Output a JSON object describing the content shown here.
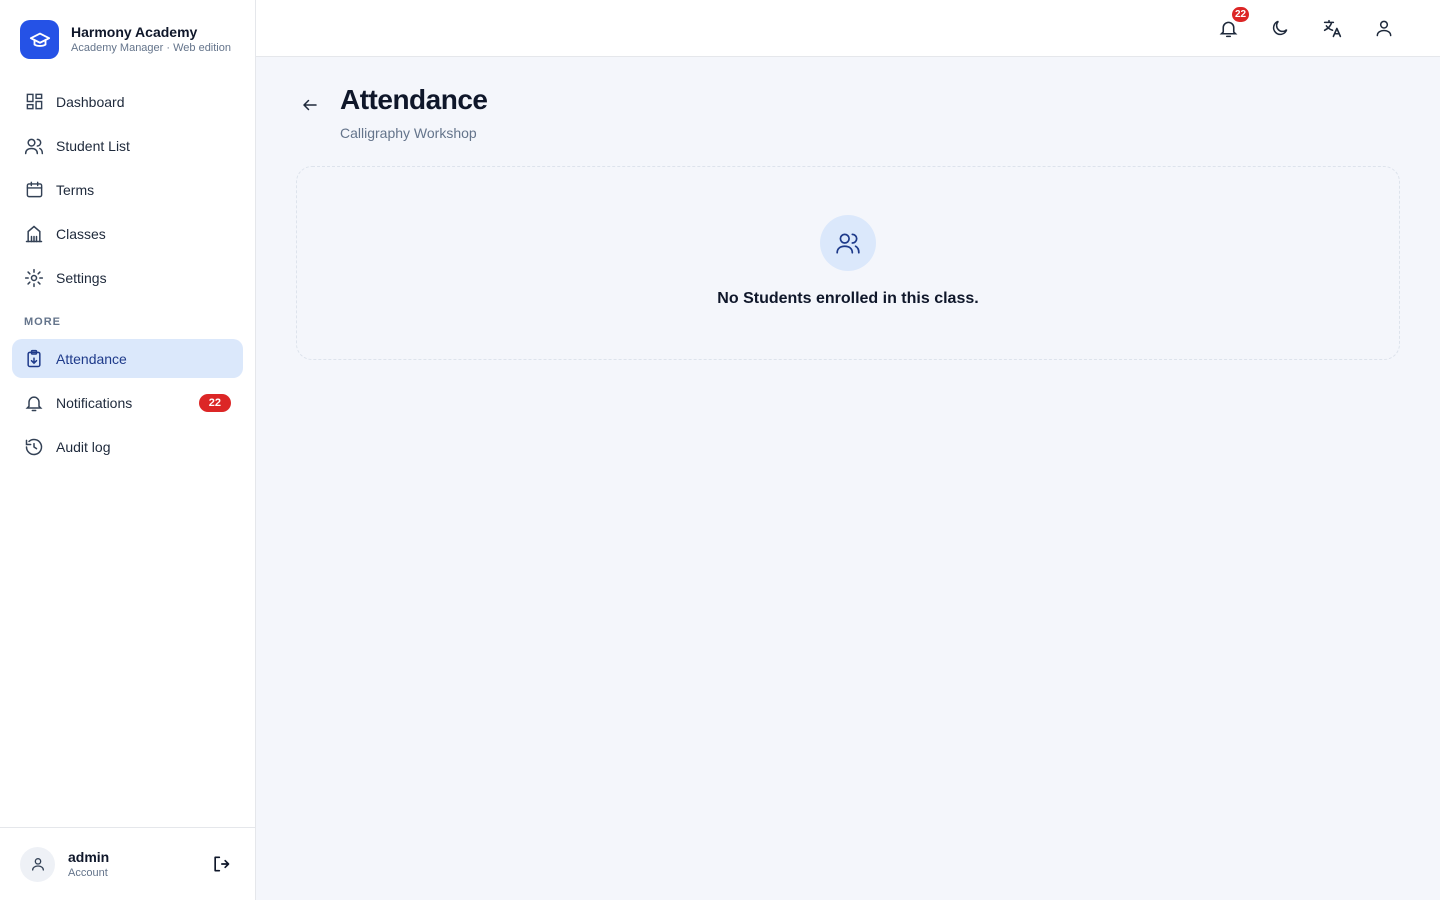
{
  "brand": {
    "name": "Harmony Academy",
    "subtitle": "Academy Manager · Web edition",
    "icon": "graduation-cap-icon",
    "color": "#2552e6"
  },
  "sidebar": {
    "items": [
      {
        "label": "Dashboard",
        "icon": "dashboard-icon"
      },
      {
        "label": "Student List",
        "icon": "users-icon"
      },
      {
        "label": "Terms",
        "icon": "calendar-icon"
      },
      {
        "label": "Classes",
        "icon": "building-icon"
      },
      {
        "label": "Settings",
        "icon": "gear-icon"
      }
    ],
    "section_label": "MORE",
    "more_items": [
      {
        "label": "Attendance",
        "icon": "clipboard-icon",
        "active": true
      },
      {
        "label": "Notifications",
        "icon": "bell-icon",
        "badge": "22"
      },
      {
        "label": "Audit log",
        "icon": "history-icon"
      }
    ],
    "active_color": "#dbe8fb"
  },
  "user": {
    "name": "admin",
    "role": "Account"
  },
  "topbar": {
    "notification_count": "22",
    "icons": [
      "bell-icon",
      "moon-icon",
      "translate-icon",
      "user-icon"
    ]
  },
  "page": {
    "title": "Attendance",
    "subtitle": "Calligraphy Workshop"
  },
  "empty_state": {
    "message": "No Students enrolled in this class.",
    "icon": "users-icon"
  },
  "colors": {
    "badge": "#dc2626",
    "background": "#f4f6fb"
  }
}
